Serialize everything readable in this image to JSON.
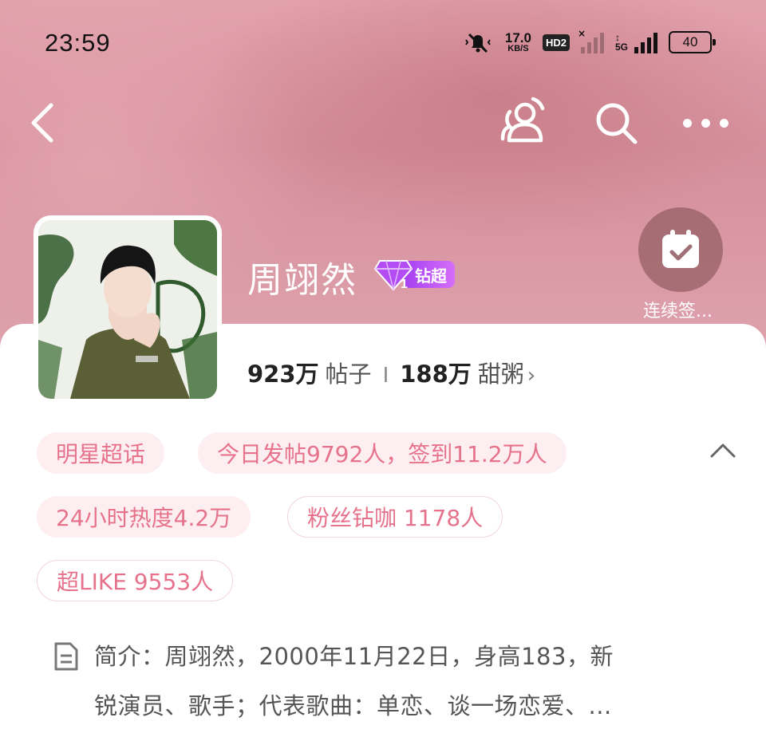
{
  "status_bar": {
    "time": "23:59",
    "speed_value": "17.0",
    "speed_unit": "KB/S",
    "hd_badge": "HD2",
    "network": "5G",
    "battery": "40"
  },
  "nav": {
    "back_icon": "chevron-left-icon",
    "users_icon": "users-icon",
    "search_icon": "search-icon",
    "more_icon": "more-icon"
  },
  "profile": {
    "name": "周翊然",
    "badge_level": "1",
    "badge_label": "钻超",
    "checkin_label": "连续签...",
    "posts_count": "923万",
    "posts_label": "帖子",
    "fans_count": "188万",
    "fans_label": "甜粥",
    "fans_chevron": "›",
    "separator": "I"
  },
  "tags": [
    "明星超话",
    "今日发帖9792人，签到11.2万人",
    "24小时热度4.2万",
    "粉丝钻咖 1178人",
    "超LIKE 9553人"
  ],
  "intro": {
    "line1": "简介：周翊然，2000年11月22日，身高183，新",
    "line2": "锐演员、歌手；代表歌曲：单恋、谈一场恋爱、..."
  },
  "colors": {
    "accent_pink": "#e6728b",
    "tag_bg": "#fdeef1",
    "badge_purple": "#a53ff2"
  }
}
